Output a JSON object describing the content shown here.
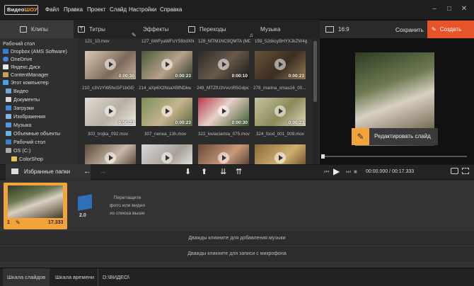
{
  "app": {
    "logo_a": "Видео",
    "logo_b": "ШОУ"
  },
  "menu": [
    "Файл",
    "Правка",
    "Проект",
    "Слайд",
    "Настройки",
    "Справка"
  ],
  "window_controls": {
    "minimize": "–",
    "maximize": "□",
    "close": "✕"
  },
  "tabs": [
    "Клипы",
    "Титры",
    "Эффекты",
    "Переходы",
    "Музыка"
  ],
  "tree": [
    {
      "label": "Рабочий стол",
      "icon": "none"
    },
    {
      "label": "Dropbox (AMS Software)",
      "icon": "dropbox-icon"
    },
    {
      "label": "OneDrive",
      "icon": "cloud-icon"
    },
    {
      "label": "Яндекс.Диск",
      "icon": "yandex-disk-icon"
    },
    {
      "label": "ContentManager",
      "icon": "user-icon"
    },
    {
      "label": "Этот компьютер",
      "icon": "computer-icon"
    },
    {
      "label": "Видео",
      "icon": "video-folder-icon"
    },
    {
      "label": "Документы",
      "icon": "documents-icon"
    },
    {
      "label": "Загрузки",
      "icon": "downloads-icon"
    },
    {
      "label": "Изображения",
      "icon": "images-icon"
    },
    {
      "label": "Музыка",
      "icon": "music-folder-icon"
    },
    {
      "label": "Объемные объекты",
      "icon": "3d-objects-icon"
    },
    {
      "label": "Рабочий стол",
      "icon": "desktop-icon"
    },
    {
      "label": "OS (C:)",
      "icon": "drive-icon"
    },
    {
      "label": "ColorShop",
      "icon": "folder-icon"
    }
  ],
  "media": [
    {
      "name": "121_10.mov",
      "dur": "0:00:30"
    },
    {
      "name": "127_bWFyaWFuYS9zdXNh...",
      "dur": "0:00:23"
    },
    {
      "name": "128_MTM1NC9QMTA (MDU...",
      "dur": "0:00:10"
    },
    {
      "name": "159_52dkcyBHYXJkZW4gc...",
      "dur": "0:00:23"
    },
    {
      "name": "210_c3VzYW5hcGF1bGEy...",
      "dur": "0:00:23"
    },
    {
      "name": "214_aXp6X2NsaXBfNDkw...",
      "dur": "0:00:23"
    },
    {
      "name": "248_MTZfU3VvcnR5Gdpc...",
      "dur": "0:00:30"
    },
    {
      "name": "278_marina_xmas16_00...",
      "dur": "0:00:23"
    },
    {
      "name": "303_trojka_092.mov",
      "dur": ""
    },
    {
      "name": "307_nenea_13h.mov",
      "dur": ""
    },
    {
      "name": "322_kwiaciarnia_075.mov",
      "dur": ""
    },
    {
      "name": "324_food_001_009.mov",
      "dur": ""
    }
  ],
  "right": {
    "ratio": "16:9",
    "save": "Сохранить",
    "create": "Создать",
    "edit_slide": "Редактировать слайд",
    "time": "00:00.000 / 00:17.333"
  },
  "mid": {
    "favorites": "Избранные папки"
  },
  "timeline": {
    "slide_num": "1",
    "slide_dur": "17.333",
    "transition_dur": "2.0",
    "drop_hint": "Перетащите\nфото или видео\nиз списка выше",
    "music_hint": "Дважды кликните для добавления музыки",
    "mic_hint": "Дважды кликните для записи с микрофона"
  },
  "bottom": {
    "slides_tab": "Шкала слайдов",
    "time_tab": "Шкала времени",
    "path": "D:\\ВИДЕО\\"
  },
  "colors": {
    "accent_orange": "#f2a33a",
    "create_button": "#e8542a"
  }
}
